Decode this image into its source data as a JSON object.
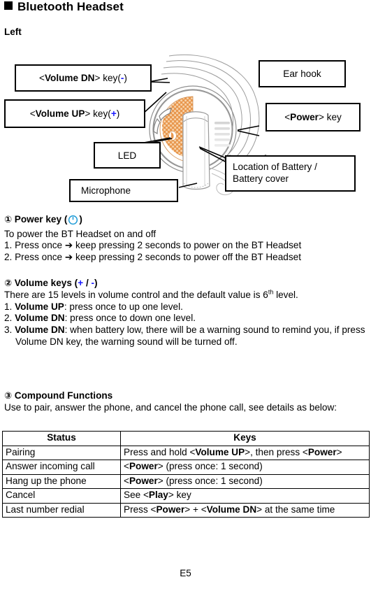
{
  "document": {
    "title": "Bluetooth Headset",
    "side_label": "Left",
    "page_number": "E5"
  },
  "figure": {
    "name": "bluetooth-headset-left-side-diagram",
    "colors": {
      "earpad_orange": "#e8974e",
      "earpad_dot": "#f6d0a6",
      "outline": "#a9a9a9",
      "outline_dark": "#000000"
    },
    "callouts": [
      {
        "id": "volume-dn",
        "label_html": "&lt;<b>Volume DN</b>&gt; key(<span class=\"minus\">-</span>)"
      },
      {
        "id": "volume-up",
        "label_html": "&lt;<b>Volume UP</b>&gt; key(<span class=\"plus\">+</span>)"
      },
      {
        "id": "led",
        "label_html": "LED"
      },
      {
        "id": "microphone",
        "label_html": "Microphone"
      },
      {
        "id": "ear-hook",
        "label_html": "Ear hook"
      },
      {
        "id": "power",
        "label_html": "&lt;<b>Power</b>&gt; key"
      },
      {
        "id": "battery",
        "label_html": "Location of Battery /<br>Battery cover"
      }
    ]
  },
  "sections": [
    {
      "id": "power-key",
      "number": "①",
      "heading": "Power key (",
      "heading_tail": ")",
      "icon": "power-icon",
      "icon_color": "#1b9ad6",
      "intro": "To power the BT Headset on and off",
      "steps": [
        "1. Press once ➔ keep pressing 2 seconds to power on the BT Headset",
        "2. Press once ➔ keep pressing 2 seconds to power off the BT Headset"
      ]
    },
    {
      "id": "volume-keys",
      "number": "②",
      "heading_html": "Volume keys (<span class=\"plus\">+</span> / <span class=\"minus\">-</span>)",
      "intro_html": "There are 15 levels in volume control and the default value is 6<sup>th</sup> level.",
      "steps_html": [
        "1. <b>Volume UP</b>: press once to up one level.",
        "2. <b>Volume DN</b>: press once to down one level.",
        "3. <b>Volume DN</b>: when battery low, there will be a warning sound to remind you, if press Volume DN key, the warning sound will be turned off."
      ]
    },
    {
      "id": "compound-functions",
      "number": "③",
      "heading": "Compound Functions",
      "intro": "Use to pair, answer the phone, and cancel the phone call, see details as below:"
    }
  ],
  "table": {
    "name": "compound-functions-table",
    "headers": [
      "Status",
      "Keys"
    ],
    "rows": [
      {
        "status": "Pairing",
        "keys_html": "Press and hold &lt;<b>Volume UP</b>&gt;, then press &lt;<b>Power</b>&gt;"
      },
      {
        "status": "Answer incoming call",
        "keys_html": "&lt;<b>Power</b>&gt; (press once: 1 second)"
      },
      {
        "status": "Hang up the phone",
        "keys_html": "&lt;<b>Power</b>&gt; (press once: 1 second)"
      },
      {
        "status": "Cancel",
        "keys_html": "See &lt;<b>Play</b>&gt; key"
      },
      {
        "status": "Last number redial",
        "keys_html": "Press &lt;<b>Power</b>&gt; + &lt;<b>Volume DN</b>&gt; at the same time"
      }
    ]
  }
}
